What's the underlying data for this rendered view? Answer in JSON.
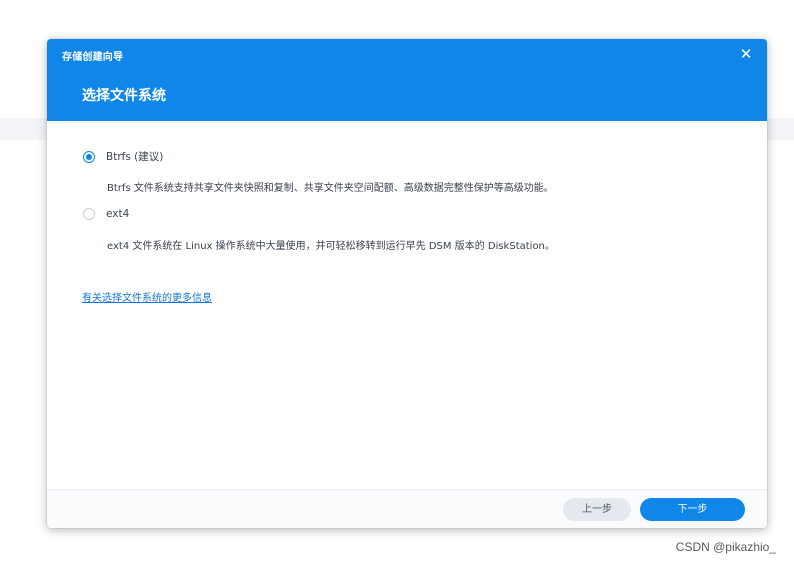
{
  "wizard": {
    "name": "存储创建向导",
    "close_icon": "close-icon",
    "title": "选择文件系统"
  },
  "options": [
    {
      "label": "Btrfs (建议)",
      "selected": true,
      "description": "Btrfs 文件系统支持共享文件夹快照和复制、共享文件夹空间配额、高级数据完整性保护等高级功能。"
    },
    {
      "label": "ext4",
      "selected": false,
      "description": "ext4 文件系统在 Linux 操作系统中大量使用，并可轻松移转到运行早先 DSM 版本的 DiskStation。"
    }
  ],
  "more_info_link": "有关选择文件系统的更多信息",
  "footer": {
    "prev_label": "上一步",
    "next_label": "下一步"
  },
  "watermark": "CSDN @pikazhio_",
  "colors": {
    "accent": "#0f86e8",
    "link": "#1776d2",
    "text": "#3a4250"
  }
}
